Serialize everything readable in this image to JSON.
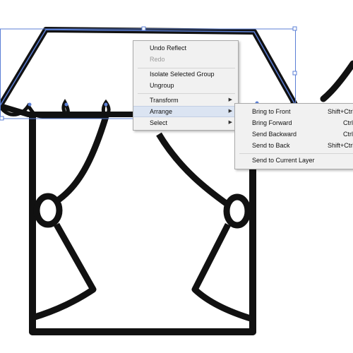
{
  "context_menu": {
    "items": [
      {
        "label": "Undo Reflect",
        "enabled": true
      },
      {
        "label": "Redo",
        "enabled": false
      },
      {
        "label": "Isolate Selected Group",
        "enabled": true
      },
      {
        "label": "Ungroup",
        "enabled": true
      },
      {
        "label": "Transform",
        "has_submenu": true
      },
      {
        "label": "Arrange",
        "has_submenu": true,
        "highlighted": true
      },
      {
        "label": "Select",
        "has_submenu": true
      }
    ],
    "submenu_arrow": "▶"
  },
  "arrange_submenu": {
    "items": [
      {
        "label": "Bring to Front",
        "shortcut": "Shift+Ctrl"
      },
      {
        "label": "Bring Forward",
        "shortcut": "Ctrl"
      },
      {
        "label": "Send Backward",
        "shortcut": "Ctrl"
      },
      {
        "label": "Send to Back",
        "shortcut": "Shift+Ctrl"
      },
      {
        "label": "Send to Current Layer",
        "shortcut": ""
      }
    ]
  },
  "colors": {
    "selection": "#5b7fd6",
    "stroke": "#111111",
    "menu_bg": "#f1f1f1",
    "highlight": "#dbe4f2"
  }
}
